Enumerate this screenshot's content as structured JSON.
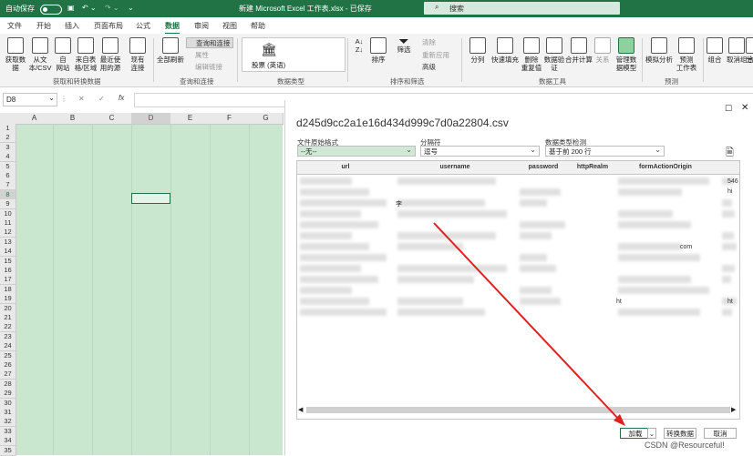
{
  "titlebar": {
    "autosave_label": "自动保存",
    "toggle_state": "关",
    "title": "新建 Microsoft Excel 工作表.xlsx - 已保存",
    "search_placeholder": "搜索"
  },
  "tabs": [
    "文件",
    "开始",
    "插入",
    "页面布局",
    "公式",
    "数据",
    "审阅",
    "视图",
    "帮助"
  ],
  "active_tab": "数据",
  "ribbon": {
    "get_transform": {
      "buttons": [
        "获取数\n据",
        "从文\n本/CSV",
        "自\n网站",
        "来自表\n格/区域",
        "最近使\n用的源",
        "现有\n连接"
      ],
      "group_label": "获取和转换数据"
    },
    "queries": {
      "refresh_all": "全部刷新",
      "items": [
        "查询和连接",
        "属性",
        "编辑链接"
      ],
      "group_label": "查询和连接"
    },
    "data_types": {
      "stock": "股票 (英语)",
      "group_label": "数据类型"
    },
    "sort_filter": {
      "sort": "排序",
      "filter": "筛选",
      "items": [
        "清除",
        "重新应用",
        "高级"
      ],
      "group_label": "排序和筛选"
    },
    "data_tools": {
      "buttons": [
        "分列",
        "快速填充",
        "删除\n重复值",
        "数据验\n证",
        "合并计算",
        "关系",
        "管理数\n据模型"
      ],
      "group_label": "数据工具"
    },
    "forecast": {
      "buttons": [
        "模拟分析",
        "预测\n工作表"
      ],
      "group_label": "预测"
    },
    "outline": {
      "buttons": [
        "组合",
        "取消组合",
        "分"
      ]
    }
  },
  "formula_bar": {
    "name_box": "D8",
    "icons": [
      "✕",
      "✓",
      "fx"
    ],
    "value": ""
  },
  "grid": {
    "columns": [
      "A",
      "B",
      "C",
      "D",
      "E",
      "F",
      "G"
    ],
    "rows": [
      "1",
      "2",
      "3",
      "4",
      "5",
      "6",
      "7",
      "8",
      "9",
      "10",
      "11",
      "12",
      "13",
      "14",
      "15",
      "16",
      "17",
      "18",
      "19",
      "20",
      "21",
      "22",
      "23",
      "24",
      "25",
      "26",
      "27",
      "28",
      "29",
      "30",
      "31",
      "32",
      "33",
      "34",
      "35"
    ],
    "selected_cell": "D8"
  },
  "dialog": {
    "filename": "d245d9cc2a1e16d434d999c7d0a22804.csv",
    "origin_label": "文件原始格式",
    "origin_value": "--无--",
    "delimiter_label": "分隔符",
    "delimiter_value": "逗号",
    "detection_label": "数据类型检测",
    "detection_value": "基于前 200 行",
    "headers": [
      "url",
      "username",
      "password",
      "httpRealm",
      "formActionOrigin",
      ""
    ],
    "cell_fragments": [
      "李",
      "com",
      "ht",
      "546",
      "hi",
      "ht"
    ],
    "buttons": {
      "load": "加载",
      "transform": "转换数据",
      "cancel": "取消"
    }
  },
  "watermark": "CSDN @Resourceful!"
}
